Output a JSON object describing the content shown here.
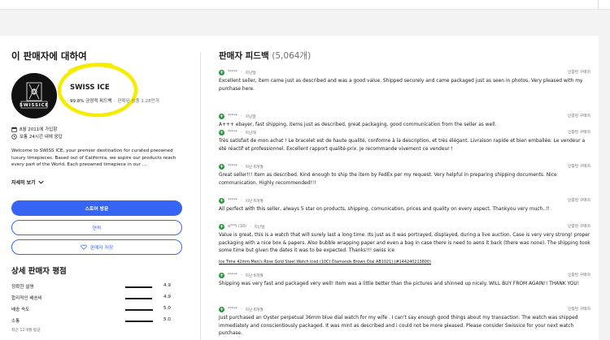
{
  "seller": {
    "section_title": "이 판매자에 대하여",
    "store_name": "SWISS ICE",
    "logo_text": "SWISSICE",
    "positive_feedback": "99.8% 긍정적 피드백",
    "items_sold": "판매된 상품 1.28만개",
    "joined": "8월 2011에 가입함",
    "response": "보통 24시간 내에 응답",
    "description": "Welcome to SWISS ICE, your premier destination for curated preowned luxury timepieces. Based out of California, we aspire our products reach every part of the World. Each preowned timepiece in our ...",
    "see_more": "자세히 보기",
    "visit_store": "스토어 방문",
    "contact": "연락",
    "save_seller": "판매자 저장"
  },
  "detailed_ratings": {
    "title": "상세 판매자 평점",
    "rows": [
      {
        "label": "정확한 설명",
        "value": "4.9",
        "fraction": 0.98
      },
      {
        "label": "합리적인 배송비",
        "value": "4.9",
        "fraction": 0.98
      },
      {
        "label": "배송 속도",
        "value": "5.0",
        "fraction": 1.0
      },
      {
        "label": "소통",
        "value": "5.0",
        "fraction": 1.0
      }
    ],
    "footnote": "최근 12개월 평균"
  },
  "feedback": {
    "title": "판매자 피드백",
    "count": "(5,064개)",
    "verified_label": "인증된 구매자",
    "items": [
      {
        "user": "*****",
        "time": "지난달",
        "text": "Excellent seller, item came just as described and was a good value. Shipped securely and came packaged just as seen in photos. Very pleased with my purchase here.",
        "link": ""
      },
      {
        "user": "*****",
        "time": "지난달",
        "text": "A+++ ebayer, fast shipping, items just as described, great packaging, good communication from the seller as well.",
        "link": ""
      },
      {
        "user": "*****",
        "time": "지난해",
        "text": "Très satisfait de mon achat ! Le bracelet est de haute qualité, conforme à la description, et très élégant. Livraison rapide et bien emballée. Le vendeur a été réactif et professionnel. Excellent rapport qualité-prix. Je recommande vivement ce vendeur !",
        "link": ""
      },
      {
        "user": "*****",
        "time": "지난 6개월",
        "text": "Great seller!!! Item as described. Kind enough to ship the item by FedEx per my request. Very helpful in preparing shipping documents. Nice communication. Highly recommended!!!",
        "link": ""
      },
      {
        "user": "*****",
        "time": "지난 6개월",
        "text": "All perfect with this seller, always 5 star on products, shipping, comunication, prices and quality on every aspect. Thankyou very much..!!",
        "link": ""
      },
      {
        "user": "a***i (10)",
        "time": "지난달",
        "text": "Value is great, this is a watch that will surely last a long time. Its just as it was portrayed, displayed, during a live auction. Case is very very strong! proper packaging with a nice box & papers. Also bubble wrapping paper and even a bag in case there is need to aens it back (there was none). The shipping took some time but given the dates it was to be expected. Thanks!!! swiss ice",
        "link": "Ice Time 42mm Men's Rose Gold Steel Watch Iced (10Ct Diamonds Brown Dial AB1021) (#144240213800)"
      },
      {
        "user": "*****",
        "time": "지난 6개월",
        "text": "Shipping was very fast and packaged very well! Item was a little better than the pictures and shinned up nicely. WILL BUY FROM AGAIN!! THANK YOU!",
        "link": ""
      },
      {
        "user": "*****",
        "time": "지난 6개월",
        "text": "Just purchased an Oyster perpetual 36mm blue dial watch for my wife . I can't say enough good things about my transaction. The watch was shipped immediately and conscientiously packaged. It was mint as described and i could not be more pleased. Please consider Swissice for your next watch purchase.",
        "link": ""
      }
    ]
  },
  "colors": {
    "accent": "#3665f3",
    "positive": "#1f9d36",
    "highlight": "#f5ec00"
  },
  "icons": [
    "calendar-icon",
    "clock-icon",
    "chevron-down-icon",
    "heart-icon",
    "positive-feedback-icon"
  ]
}
